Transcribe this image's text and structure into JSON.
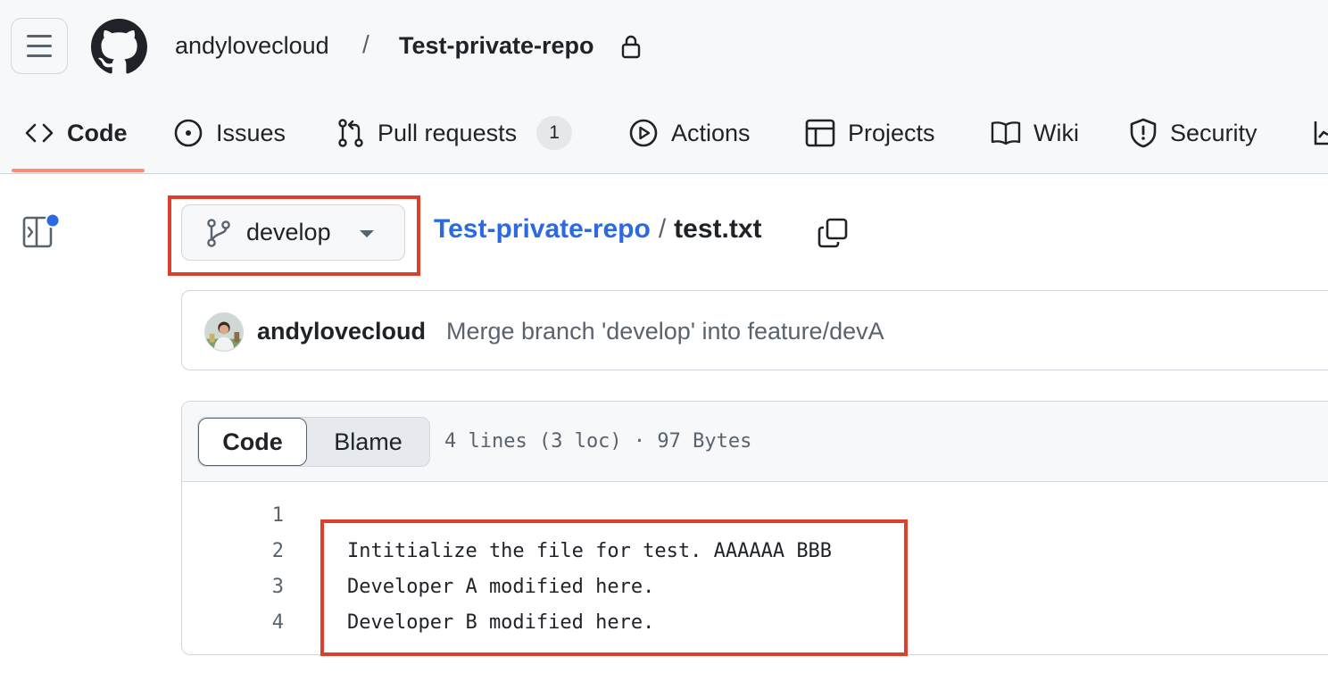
{
  "header": {
    "owner": "andylovecloud",
    "separator": "/",
    "repo": "Test-private-repo"
  },
  "tabs": [
    {
      "label": "Code",
      "icon": "code-icon"
    },
    {
      "label": "Issues",
      "icon": "issue-opened-icon"
    },
    {
      "label": "Pull requests",
      "icon": "git-pull-request-icon",
      "count": "1"
    },
    {
      "label": "Actions",
      "icon": "play-icon"
    },
    {
      "label": "Projects",
      "icon": "table-icon"
    },
    {
      "label": "Wiki",
      "icon": "book-icon"
    },
    {
      "label": "Security",
      "icon": "shield-icon"
    }
  ],
  "branch": {
    "name": "develop"
  },
  "breadcrumb": {
    "repo": "Test-private-repo",
    "separator": "/",
    "file": "test.txt"
  },
  "commit": {
    "author": "andylovecloud",
    "message": "Merge branch 'develop' into feature/devA"
  },
  "file": {
    "view_code": "Code",
    "view_blame": "Blame",
    "meta": "4 lines (3 loc) · 97 Bytes",
    "lines": [
      {
        "num": "1",
        "text": ""
      },
      {
        "num": "2",
        "text": "Intitialize the file for test. AAAAAA BBB"
      },
      {
        "num": "3",
        "text": "Developer A modified here."
      },
      {
        "num": "4",
        "text": "Developer B modified here."
      }
    ]
  },
  "colors": {
    "accent_link": "#2c6ae0",
    "highlight_box": "#dc3f2c",
    "tab_underline": "#fd8c73",
    "notification_dot": "#2c6ae0"
  }
}
